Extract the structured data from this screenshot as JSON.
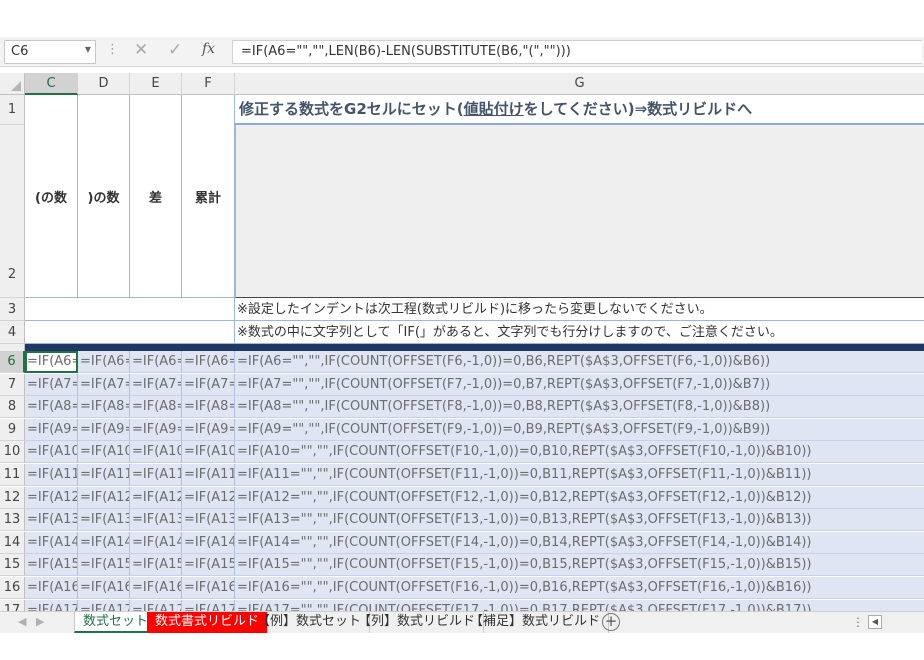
{
  "formula_bar": {
    "name_box": "C6",
    "formula": "=IF(A6=\"\",\"\",LEN(B6)-LEN(SUBSTITUTE(B6,\"(\",\"\")))"
  },
  "columns": [
    "C",
    "D",
    "E",
    "F",
    "G"
  ],
  "headers": {
    "c": "(の数",
    "d": ")の数",
    "e": "差",
    "f": "累計"
  },
  "g1": {
    "before": "修正する数式をG2セルにセット(",
    "underlined": "値貼付け",
    "after": "をしてください)⇒数式リビルドへ"
  },
  "notes": {
    "row3": "※設定したインデントは次工程(数式リビルド)に移ったら変更しないでください。",
    "row4": "※数式の中に文字列として「IF(」があると、文字列でも行分けしますので、ご注意ください。"
  },
  "rows": [
    {
      "num": "6",
      "c": "=IF(A6=",
      "d": "=IF(A6=",
      "e": "=IF(A6=",
      "f": "=IF(A6=",
      "g": "=IF(A6=\"\",\"\",IF(COUNT(OFFSET(F6,-1,0))=0,B6,REPT($A$3,OFFSET(F6,-1,0))&B6))"
    },
    {
      "num": "7",
      "c": "=IF(A7=",
      "d": "=IF(A7=",
      "e": "=IF(A7=",
      "f": "=IF(A7=",
      "g": "=IF(A7=\"\",\"\",IF(COUNT(OFFSET(F7,-1,0))=0,B7,REPT($A$3,OFFSET(F7,-1,0))&B7))"
    },
    {
      "num": "8",
      "c": "=IF(A8=",
      "d": "=IF(A8=",
      "e": "=IF(A8=",
      "f": "=IF(A8=",
      "g": "=IF(A8=\"\",\"\",IF(COUNT(OFFSET(F8,-1,0))=0,B8,REPT($A$3,OFFSET(F8,-1,0))&B8))"
    },
    {
      "num": "9",
      "c": "=IF(A9=",
      "d": "=IF(A9=",
      "e": "=IF(A9=",
      "f": "=IF(A9=",
      "g": "=IF(A9=\"\",\"\",IF(COUNT(OFFSET(F9,-1,0))=0,B9,REPT($A$3,OFFSET(F9,-1,0))&B9))"
    },
    {
      "num": "10",
      "c": "=IF(A10",
      "d": "=IF(A10",
      "e": "=IF(A10",
      "f": "=IF(A10",
      "g": "=IF(A10=\"\",\"\",IF(COUNT(OFFSET(F10,-1,0))=0,B10,REPT($A$3,OFFSET(F10,-1,0))&B10))"
    },
    {
      "num": "11",
      "c": "=IF(A11",
      "d": "=IF(A11",
      "e": "=IF(A11",
      "f": "=IF(A11",
      "g": "=IF(A11=\"\",\"\",IF(COUNT(OFFSET(F11,-1,0))=0,B11,REPT($A$3,OFFSET(F11,-1,0))&B11))"
    },
    {
      "num": "12",
      "c": "=IF(A12",
      "d": "=IF(A12",
      "e": "=IF(A12",
      "f": "=IF(A12",
      "g": "=IF(A12=\"\",\"\",IF(COUNT(OFFSET(F12,-1,0))=0,B12,REPT($A$3,OFFSET(F12,-1,0))&B12))"
    },
    {
      "num": "13",
      "c": "=IF(A13",
      "d": "=IF(A13",
      "e": "=IF(A13",
      "f": "=IF(A13",
      "g": "=IF(A13=\"\",\"\",IF(COUNT(OFFSET(F13,-1,0))=0,B13,REPT($A$3,OFFSET(F13,-1,0))&B13))"
    },
    {
      "num": "14",
      "c": "=IF(A14",
      "d": "=IF(A14",
      "e": "=IF(A14",
      "f": "=IF(A14",
      "g": "=IF(A14=\"\",\"\",IF(COUNT(OFFSET(F14,-1,0))=0,B14,REPT($A$3,OFFSET(F14,-1,0))&B14))"
    },
    {
      "num": "15",
      "c": "=IF(A15",
      "d": "=IF(A15",
      "e": "=IF(A15",
      "f": "=IF(A15",
      "g": "=IF(A15=\"\",\"\",IF(COUNT(OFFSET(F15,-1,0))=0,B15,REPT($A$3,OFFSET(F15,-1,0))&B15))"
    },
    {
      "num": "16",
      "c": "=IF(A16",
      "d": "=IF(A16",
      "e": "=IF(A16",
      "f": "=IF(A16",
      "g": "=IF(A16=\"\",\"\",IF(COUNT(OFFSET(F16,-1,0))=0,B16,REPT($A$3,OFFSET(F16,-1,0))&B16))"
    },
    {
      "num": "17",
      "c": "=IF(A17",
      "d": "=IF(A17",
      "e": "=IF(A17",
      "f": "=IF(A17",
      "g": "=IF(A17=\"\",\"\",IF(COUNT(OFFSET(F17,-1,0))=0,B17,REPT($A$3,OFFSET(F17,-1,0))&B17))"
    }
  ],
  "tabs": [
    "数式セット",
    "数式書式リビルド",
    "【例】数式セット",
    "【列】数式リビルド",
    "【補足】数式リビルド"
  ],
  "colors": {
    "accent": "#217346",
    "tab_red": "#ff0000",
    "navy": "#1f3864",
    "data_fill": "#dfe5f3"
  }
}
